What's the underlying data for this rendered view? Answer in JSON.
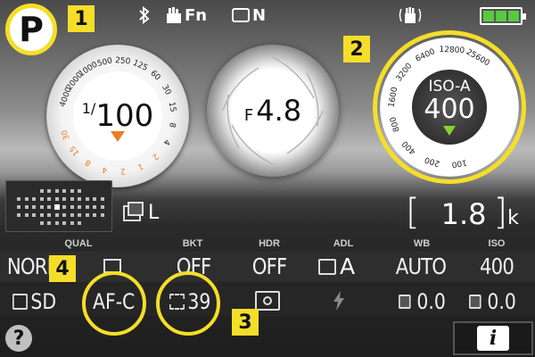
{
  "status_bar": {
    "mode": "P",
    "bluetooth_icon": "bluetooth-icon",
    "fn_label": "Fn",
    "picture_control_label": "N",
    "vr_icon": "vibration-reduction-icon",
    "battery_level": 1.0,
    "battery_color": "#59c940"
  },
  "callouts": [
    "1",
    "2",
    "3",
    "4"
  ],
  "callout_color": "#f5de29",
  "shutter": {
    "numerator": "1/",
    "value": "100",
    "scale_labels": [
      "4000",
      "2000",
      "1000",
      "500",
      "250",
      "125",
      "60",
      "30",
      "15",
      "8",
      "4",
      "2",
      "1",
      "2",
      "4",
      "8",
      "15",
      "30"
    ],
    "marker_color": "#f07c22"
  },
  "aperture": {
    "prefix": "F",
    "value": "4.8"
  },
  "iso": {
    "label": "ISO-A",
    "value": "400",
    "scale_labels": [
      "25600",
      "12800",
      "6400",
      "3200",
      "1600",
      "800",
      "400",
      "200",
      "100"
    ],
    "marker_color": "#8bd12b"
  },
  "release_mode": {
    "label": "L"
  },
  "shots_remaining": {
    "open": "[",
    "value": "1.8",
    "close": "]",
    "unit": "k"
  },
  "settings_headers": [
    "QUAL",
    "BKT",
    "HDR",
    "ADL",
    "WB",
    "ISO"
  ],
  "settings_row1": {
    "qual": "NORM",
    "bkt": "OFF",
    "hdr": "OFF",
    "adl": "A",
    "wb": "AUTO",
    "iso": "400"
  },
  "settings_row2": {
    "card": "SD",
    "af_mode": "AF-C",
    "af_area": "39",
    "flash_comp": "0.0",
    "exposure_comp": "0.0"
  },
  "help_label": "?",
  "info_label": "i"
}
